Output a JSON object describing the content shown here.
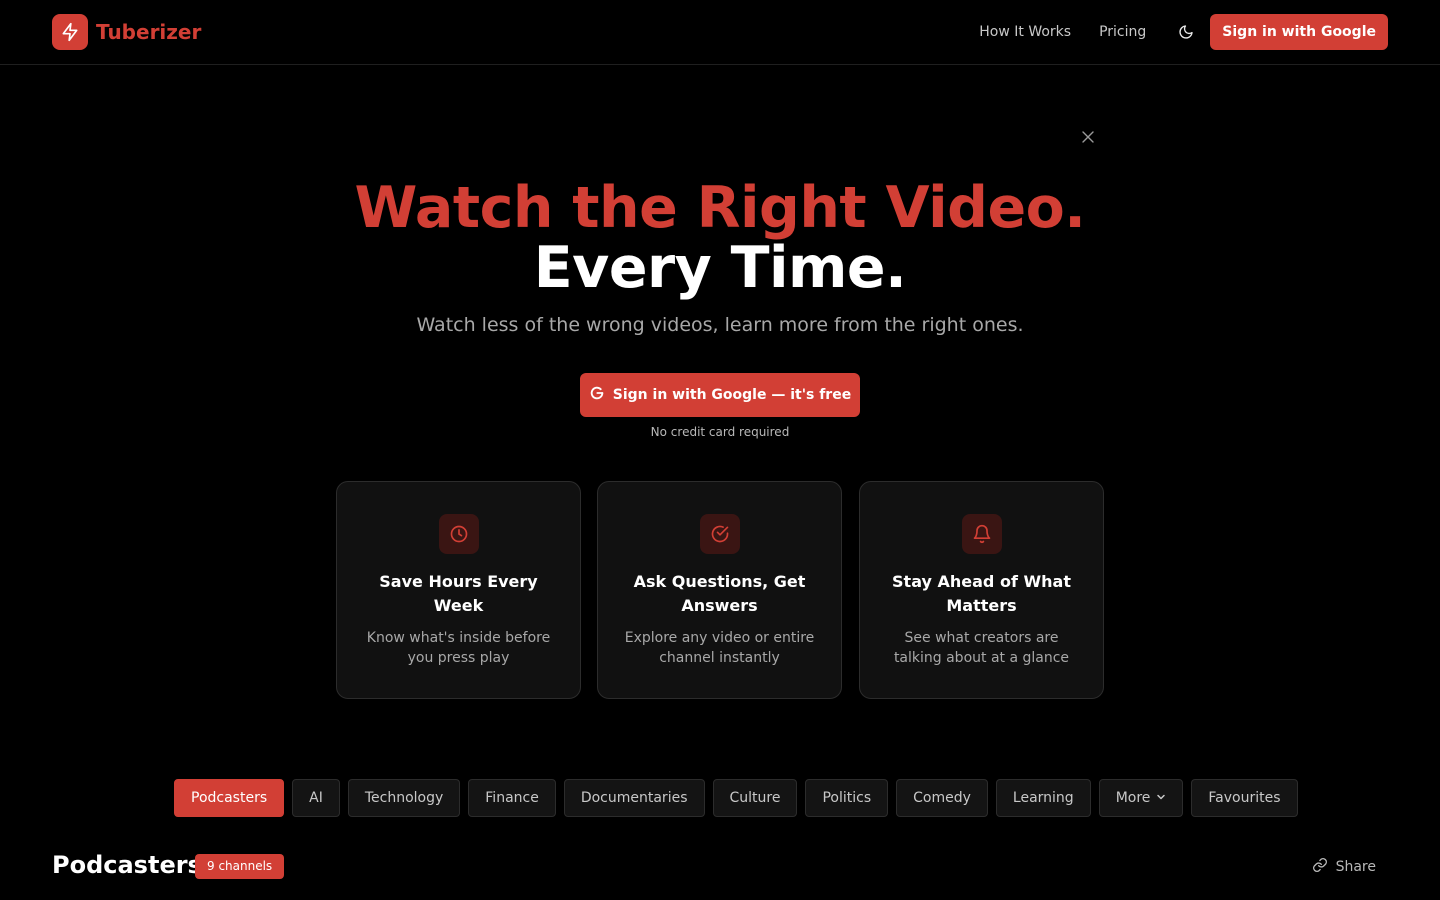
{
  "header": {
    "brand": "Tuberizer",
    "nav": [
      {
        "label": "How It Works"
      },
      {
        "label": "Pricing"
      }
    ],
    "theme_icon": "moon-icon",
    "signin_label": "Sign in with Google"
  },
  "hero": {
    "title_line1": "Watch the Right Video.",
    "title_line2": "Every Time.",
    "subtitle": "Watch less of the wrong videos, learn more from the right ones.",
    "cta_label": "Sign in with Google — it's free",
    "note": "No credit card required"
  },
  "features": [
    {
      "icon": "clock-icon",
      "title": "Save Hours Every Week",
      "desc": "Know what's inside before you press play"
    },
    {
      "icon": "check-circle-icon",
      "title": "Ask Questions, Get Answers",
      "desc": "Explore any video or entire channel instantly"
    },
    {
      "icon": "bell-icon",
      "title": "Stay Ahead of What Matters",
      "desc": "See what creators are talking about at a glance"
    }
  ],
  "categories": [
    {
      "label": "Podcasters",
      "active": true
    },
    {
      "label": "AI"
    },
    {
      "label": "Technology"
    },
    {
      "label": "Finance"
    },
    {
      "label": "Documentaries"
    },
    {
      "label": "Culture"
    },
    {
      "label": "Politics"
    },
    {
      "label": "Comedy"
    },
    {
      "label": "Learning"
    },
    {
      "label": "More"
    },
    {
      "label": "Favourites"
    }
  ],
  "section": {
    "title": "Podcasters",
    "badge": "9 channels",
    "share_label": "Share"
  },
  "colors": {
    "accent": "#d23f35",
    "background": "#000000",
    "card": "#111111"
  }
}
